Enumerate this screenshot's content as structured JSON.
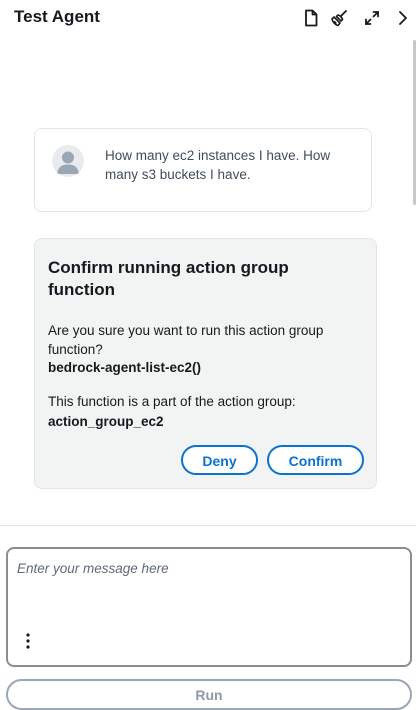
{
  "header": {
    "title": "Test Agent",
    "icons": [
      "document-icon",
      "broom-icon",
      "expand-icon",
      "chevron-right-icon"
    ]
  },
  "user_message": {
    "text": "How many ec2 instances I have. How many s3 buckets I have."
  },
  "confirmation": {
    "title": "Confirm running action group function",
    "question": "Are you sure you want to run this action group function?",
    "function_name": "bedrock-agent-list-ec2()",
    "group_text": "This function is a part of the action group:",
    "group_name": "action_group_ec2",
    "deny_label": "Deny",
    "confirm_label": "Confirm"
  },
  "input": {
    "placeholder": "Enter your message here",
    "value": ""
  },
  "run_label": "Run",
  "colors": {
    "accent": "#0972d3",
    "card_bg": "#f2f3f3",
    "border": "#e3e5e8",
    "disabled": "#9ba7b6"
  }
}
